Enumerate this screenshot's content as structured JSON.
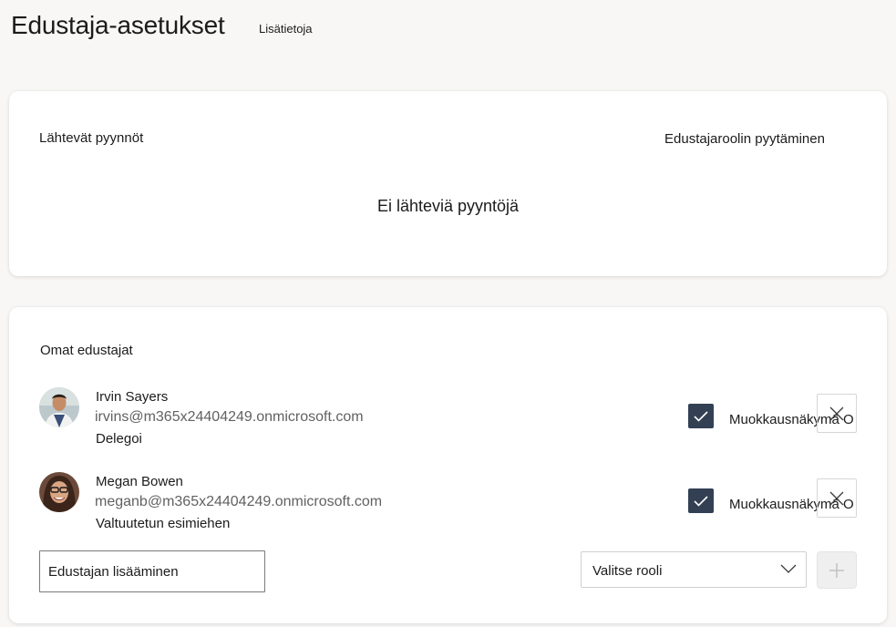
{
  "header": {
    "title": "Edustaja-asetukset",
    "learn_more": "Lisätietoja"
  },
  "outgoing": {
    "label": "Lähtevät pyynnöt",
    "request_role": "Edustajaroolin pyytäminen",
    "empty_message": "Ei lähteviä pyyntöjä"
  },
  "delegates": {
    "label": "Omat edustajat",
    "items": [
      {
        "name": "Irvin Sayers",
        "email": "irvins@m365x24404249.onmicrosoft.com",
        "role": "Delegoi",
        "checkbox_label": "Muokkausnäkymä O",
        "checked": true
      },
      {
        "name": "Megan Bowen",
        "email": "meganb@m365x24404249.onmicrosoft.com",
        "role": "Valtuutetun esimiehen",
        "checkbox_label": "Muokkausnäkymä O",
        "checked": true
      }
    ],
    "add_placeholder": "Edustajan lisääminen",
    "role_select_value": "Valitse rooli"
  },
  "icons": {
    "check": "checkmark-icon",
    "remove": "close-icon",
    "dropdown": "chevron-down-icon",
    "add": "plus-icon"
  },
  "colors": {
    "background": "#f8f7f6",
    "card": "#ffffff",
    "checkbox": "#334054",
    "secondary_text": "#616161"
  }
}
